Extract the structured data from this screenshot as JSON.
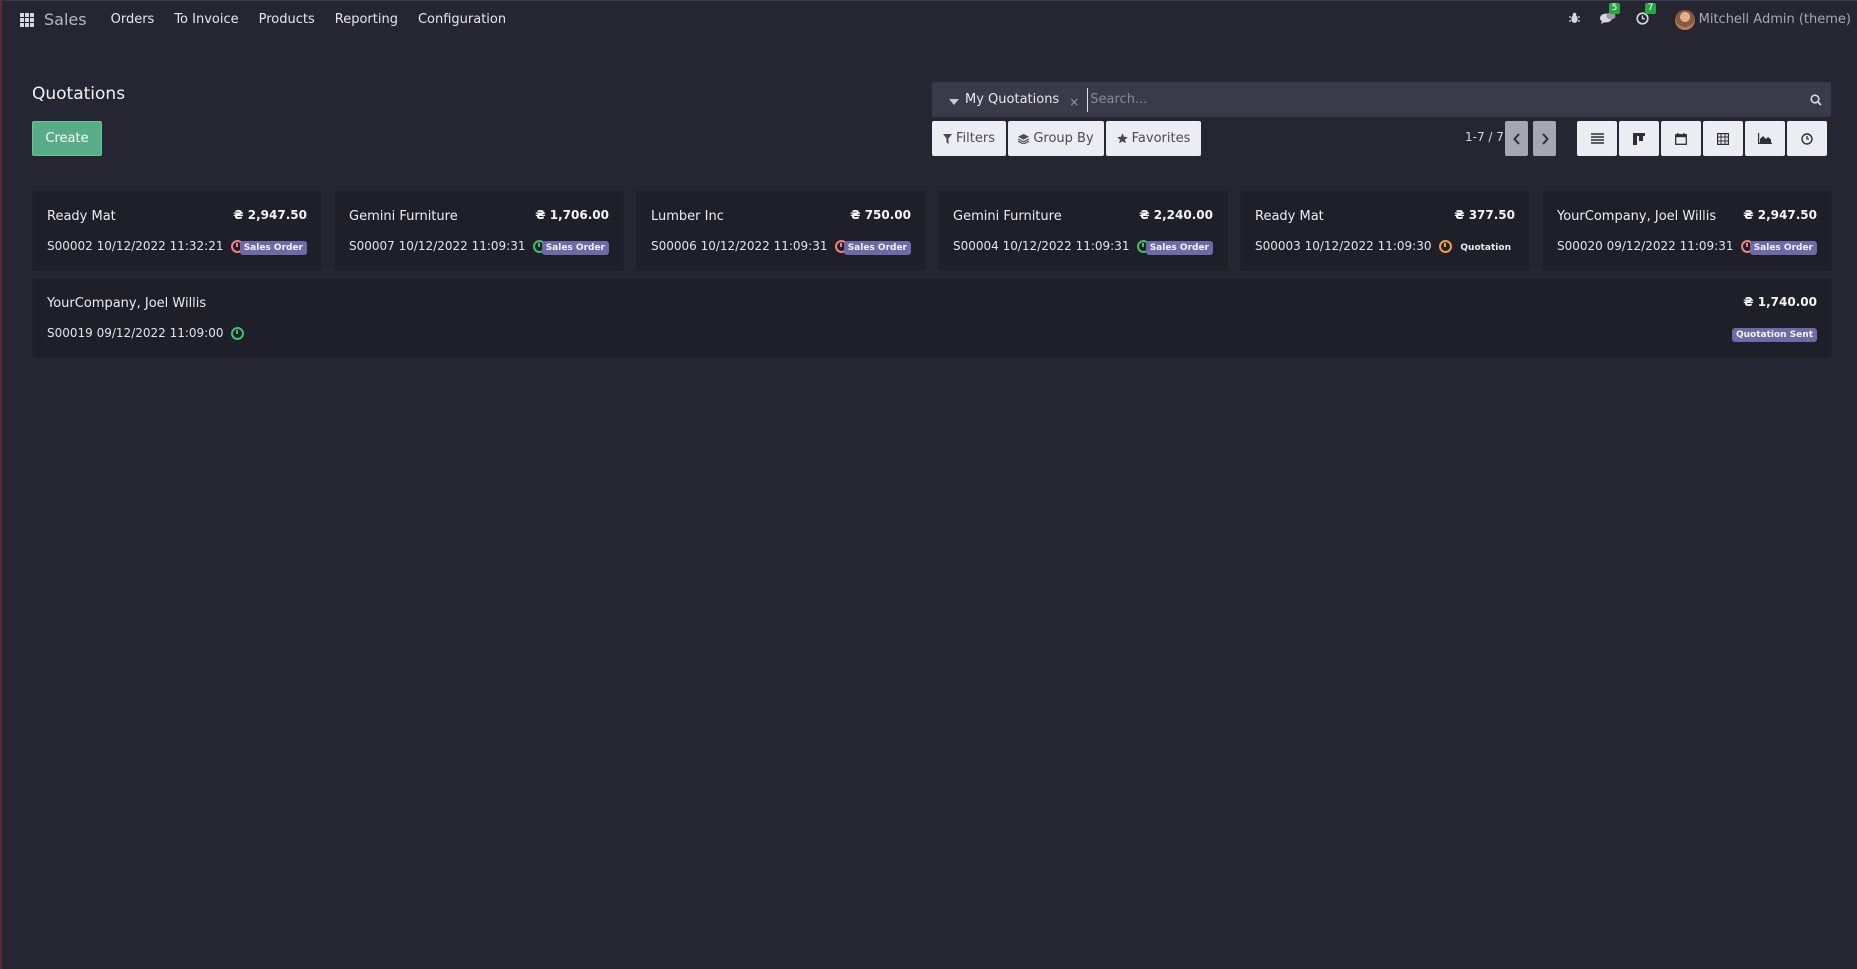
{
  "navbar": {
    "brand": "Sales",
    "menu": [
      "Orders",
      "To Invoice",
      "Products",
      "Reporting",
      "Configuration"
    ],
    "messages_count": "5",
    "activities_count": "7",
    "user_name": "Mitchell Admin (theme)"
  },
  "control_panel": {
    "title": "Quotations",
    "create_label": "Create",
    "search": {
      "facet_label": "My Quotations",
      "facet_remove": "×",
      "placeholder": "Search..."
    },
    "filters_label": "Filters",
    "group_by_label": "Group By",
    "favorites_label": "Favorites",
    "pager": "1-7 / 7",
    "views": [
      "list-view",
      "kanban-view",
      "calendar-view",
      "pivot-view",
      "graph-view",
      "activity-view"
    ]
  },
  "cards": [
    {
      "partner": "Ready Mat",
      "amount": "₴ 2,947.50",
      "ref_date": "S00002 10/12/2022 11:32:21",
      "activity": "red",
      "state": "Sales Order"
    },
    {
      "partner": "Gemini Furniture",
      "amount": "₴ 1,706.00",
      "ref_date": "S00007 10/12/2022 11:09:31",
      "activity": "green",
      "state": "Sales Order"
    },
    {
      "partner": "Lumber Inc",
      "amount": "₴ 750.00",
      "ref_date": "S00006 10/12/2022 11:09:31",
      "activity": "red",
      "state": "Sales Order"
    },
    {
      "partner": "Gemini Furniture",
      "amount": "₴ 2,240.00",
      "ref_date": "S00004 10/12/2022 11:09:31",
      "activity": "green",
      "state": "Sales Order"
    },
    {
      "partner": "Ready Mat",
      "amount": "₴ 377.50",
      "ref_date": "S00003 10/12/2022 11:09:30",
      "activity": "orange",
      "state": "Quotation"
    },
    {
      "partner": "YourCompany, Joel Willis",
      "amount": "₴ 2,947.50",
      "ref_date": "S00020 09/12/2022 11:09:31",
      "activity": "red",
      "state": "Sales Order"
    },
    {
      "partner": "YourCompany, Joel Willis",
      "amount": "₴ 1,740.00",
      "ref_date": "S00019 09/12/2022 11:09:00",
      "activity": "green",
      "state": "Quotation Sent"
    }
  ],
  "colors": {
    "background": "#262632",
    "card": "#1f1f29",
    "primary": "#59ad86",
    "state_badge": "#6e6aa8",
    "badge_green": "#28a745"
  }
}
